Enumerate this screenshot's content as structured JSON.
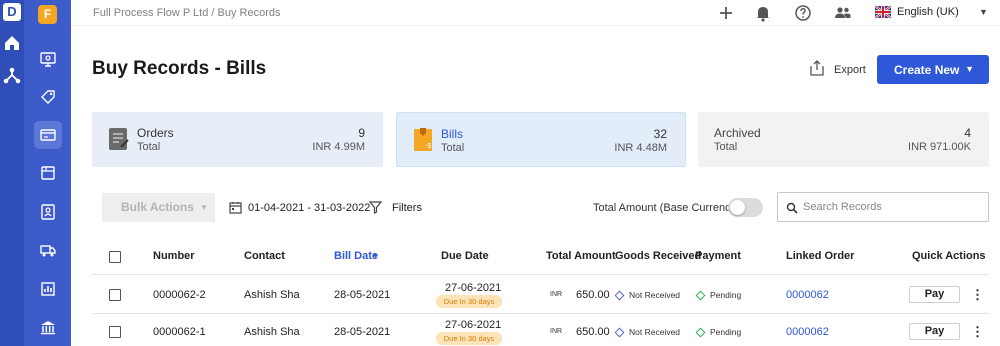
{
  "topbar": {
    "breadcrumb": "Full Process Flow P Ltd / Buy Records",
    "language": "English (UK)"
  },
  "sidebar": {
    "org_badge": "F",
    "app_logo": "D"
  },
  "header": {
    "title": "Buy Records - Bills",
    "export_label": "Export",
    "create_label": "Create New"
  },
  "cards": [
    {
      "name": "Orders",
      "sub": "Total",
      "count": "9",
      "amount": "INR 4.99M"
    },
    {
      "name": "Bills",
      "sub": "Total",
      "count": "32",
      "amount": "INR 4.48M"
    },
    {
      "name": "Archived",
      "sub": "Total",
      "count": "4",
      "amount": "INR 971.00K"
    }
  ],
  "toolbar": {
    "bulk_actions": "Bulk Actions",
    "date_range": "01-04-2021 - 31-03-2022",
    "filters": "Filters",
    "toggle_label": "Total Amount (Base Currency)",
    "search_placeholder": "Search Records"
  },
  "table": {
    "columns": [
      "Number",
      "Contact",
      "Bill Date",
      "Due Date",
      "Total Amount",
      "Goods Received",
      "Payment",
      "Linked Order",
      "Quick Actions"
    ],
    "rows": [
      {
        "number": "0000062-2",
        "contact": "Ashish Sha",
        "bill_date": "28-05-2021",
        "due_date": "27-06-2021",
        "due_badge": "Due In 30 days",
        "currency": "INR",
        "amount": "650.00",
        "goods": "Not Received",
        "payment": "Pending",
        "linked_order": "0000062",
        "action": "Pay"
      },
      {
        "number": "0000062-1",
        "contact": "Ashish Sha",
        "bill_date": "28-05-2021",
        "due_date": "27-06-2021",
        "due_badge": "Due In 30 days",
        "currency": "INR",
        "amount": "650.00",
        "goods": "Not Received",
        "payment": "Pending",
        "linked_order": "0000062",
        "action": "Pay"
      }
    ]
  },
  "colors": {
    "primary": "#2f58d8",
    "rail": "#2f4eb8",
    "badge": "#f5a623"
  }
}
